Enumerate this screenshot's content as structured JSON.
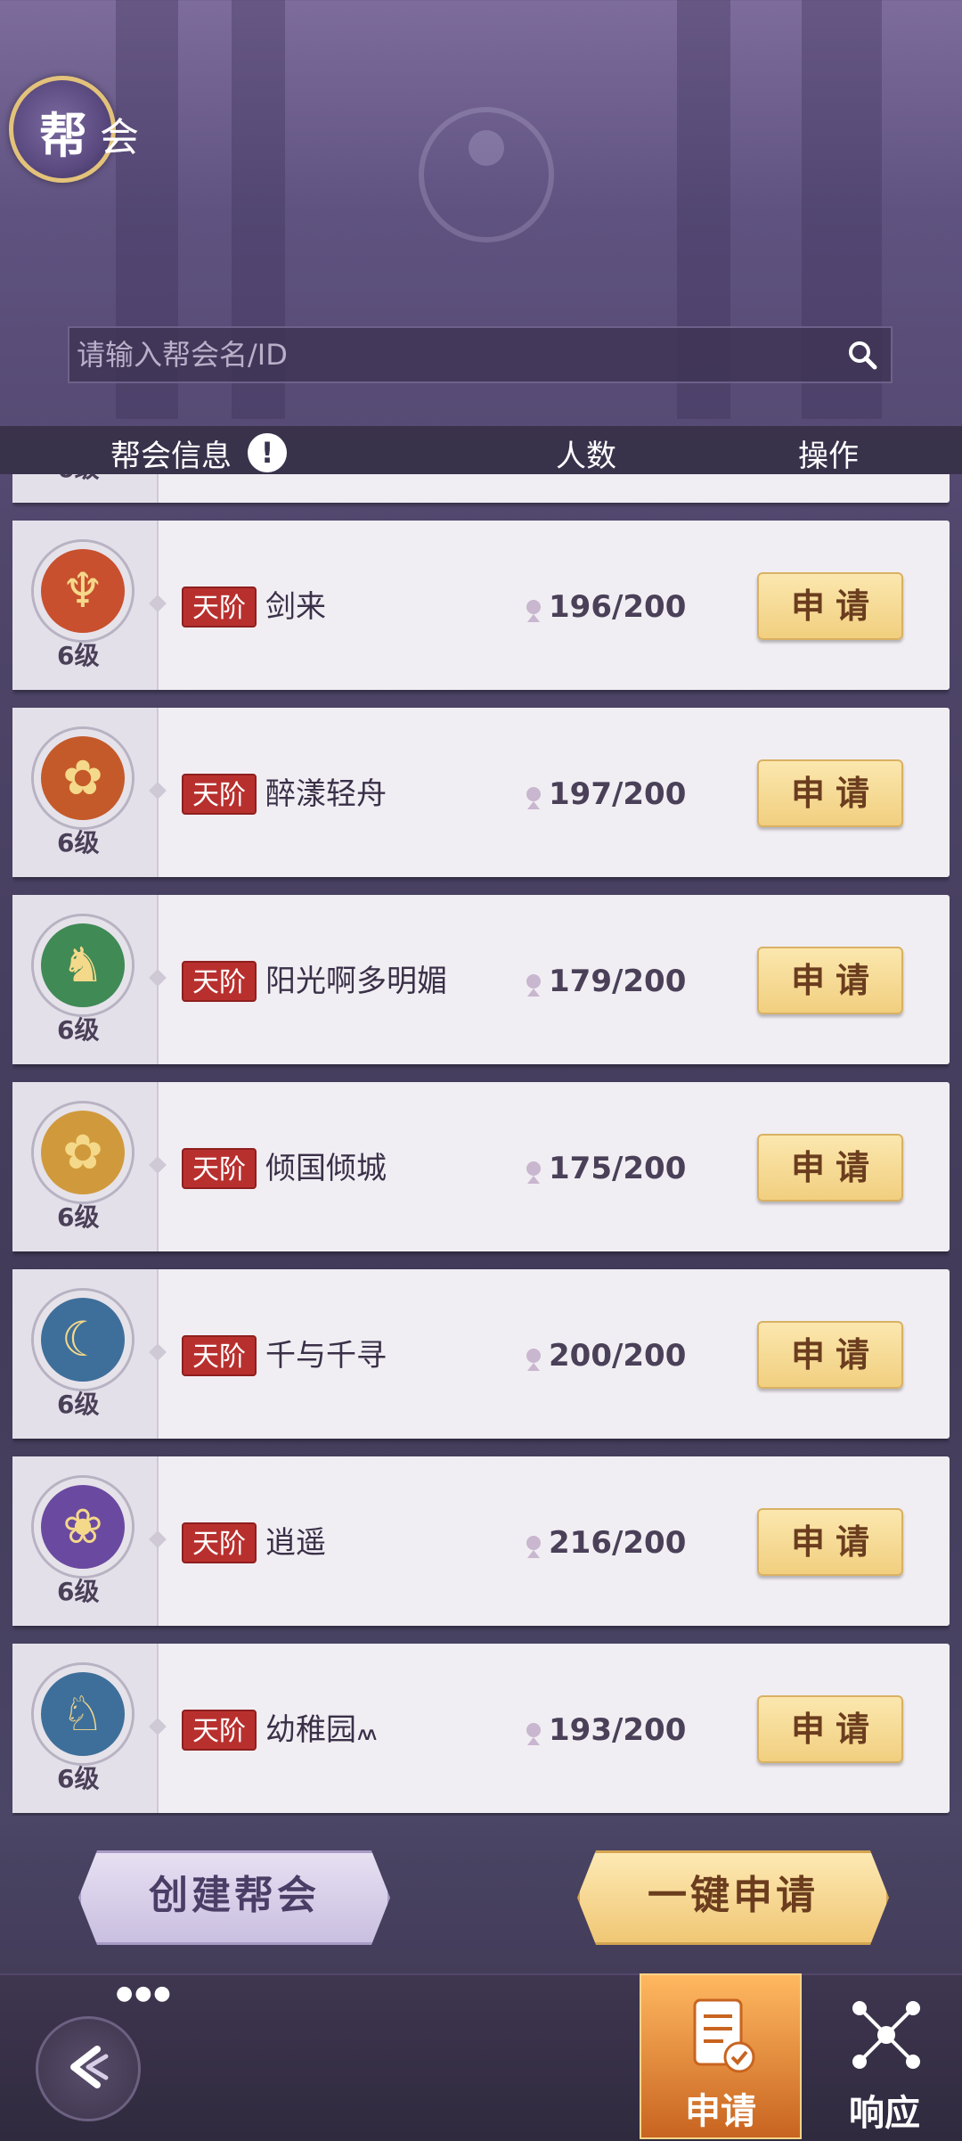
{
  "header": {
    "title_char1": "帮",
    "title_char2": "会"
  },
  "search": {
    "placeholder": "请输入帮会名/ID"
  },
  "table_header": {
    "info": "帮会信息",
    "members": "人数",
    "action": "操作"
  },
  "partial_row": {
    "level": "6级"
  },
  "guilds": [
    {
      "emblem": "figure-emblem-icon",
      "emblem_color": "#c8502e",
      "level": "6级",
      "tier": "天阶",
      "name": "剑来",
      "members": "196/200",
      "apply": "申请"
    },
    {
      "emblem": "fox-emblem-icon",
      "emblem_color": "#c45a2a",
      "level": "6级",
      "tier": "天阶",
      "name": "醉漾轻舟",
      "members": "197/200",
      "apply": "申请"
    },
    {
      "emblem": "wolf-emblem-icon",
      "emblem_color": "#3f8a55",
      "level": "6级",
      "tier": "天阶",
      "name": "阳光啊多明媚",
      "members": "179/200",
      "apply": "申请"
    },
    {
      "emblem": "fox-emblem-icon",
      "emblem_color": "#d09a3c",
      "level": "6级",
      "tier": "天阶",
      "name": "倾国倾城",
      "members": "175/200",
      "apply": "申请"
    },
    {
      "emblem": "moon-emblem-icon",
      "emblem_color": "#3e6f9a",
      "level": "6级",
      "tier": "天阶",
      "name": "千与千寻",
      "members": "200/200",
      "apply": "申请"
    },
    {
      "emblem": "lotus-emblem-icon",
      "emblem_color": "#6a4aa0",
      "level": "6级",
      "tier": "天阶",
      "name": "逍遥",
      "members": "216/200",
      "apply": "申请"
    },
    {
      "emblem": "tiger-emblem-icon",
      "emblem_color": "#3e6f9a",
      "level": "6级",
      "tier": "天阶",
      "name": "幼稚园៳",
      "members": "193/200",
      "apply": "申请"
    }
  ],
  "actions": {
    "create": "创建帮会",
    "one_click_apply": "一键申请"
  },
  "nav": {
    "apply": "申请",
    "respond": "响应"
  }
}
